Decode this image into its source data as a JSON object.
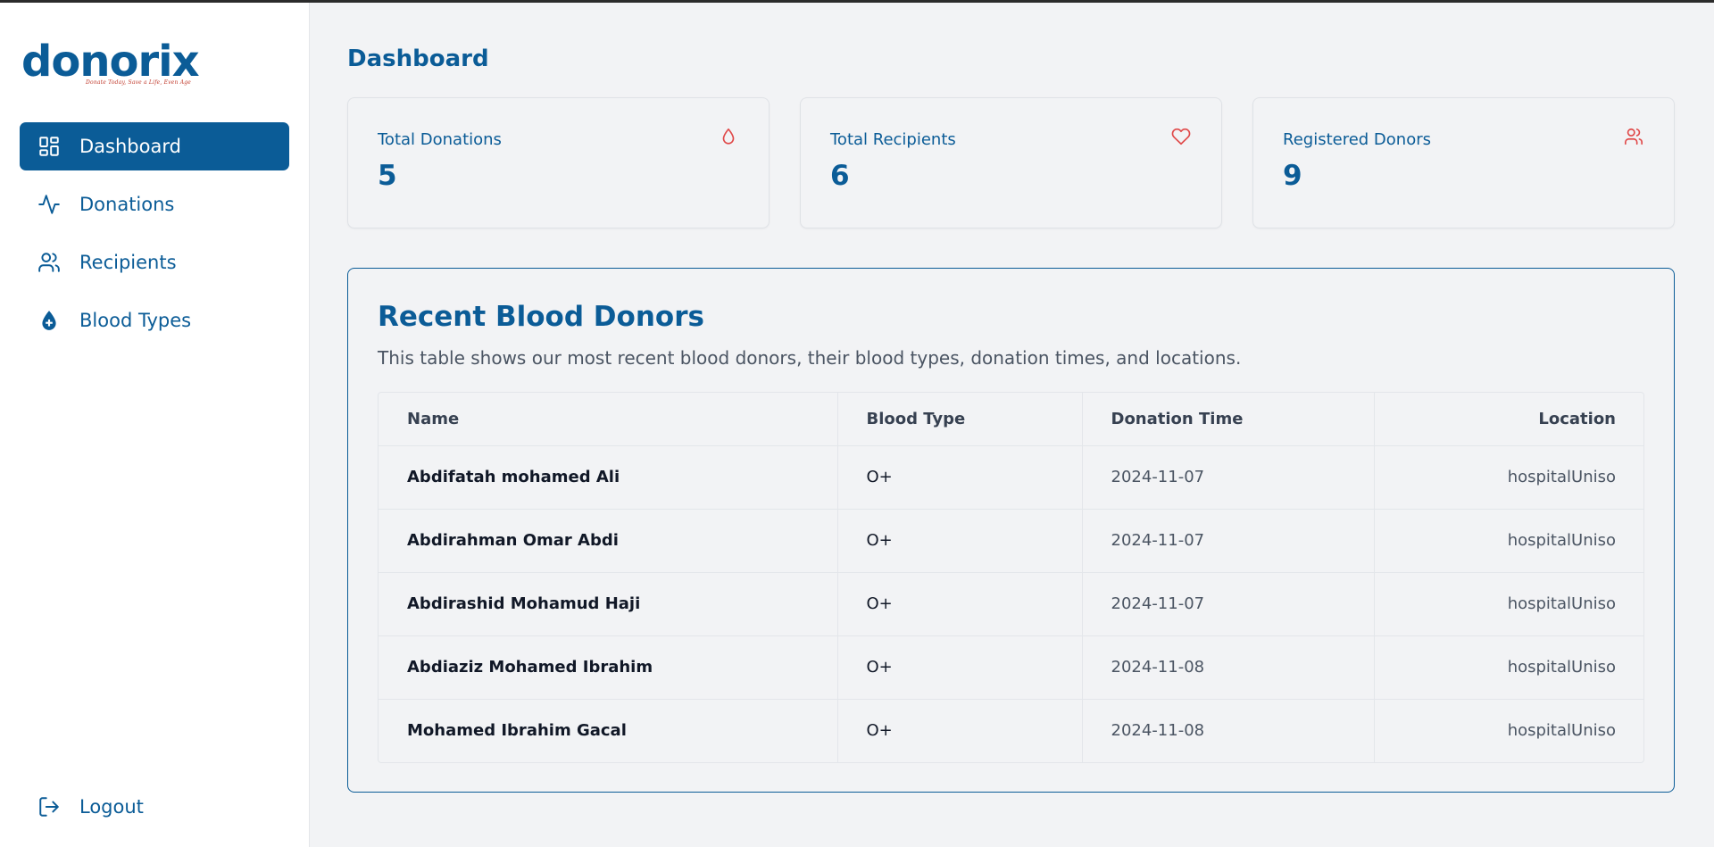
{
  "brand": {
    "name": "donorix",
    "tagline": "Donate Today, Save a Life, Even Age"
  },
  "colors": {
    "primary": "#0b5c97",
    "accent_red": "#e04848",
    "background": "#f2f3f5"
  },
  "sidebar": {
    "items": [
      {
        "label": "Dashboard",
        "icon": "grid-icon",
        "active": true
      },
      {
        "label": "Donations",
        "icon": "activity-icon",
        "active": false
      },
      {
        "label": "Recipients",
        "icon": "users-icon",
        "active": false
      },
      {
        "label": "Blood Types",
        "icon": "blood-drop-icon",
        "active": false
      }
    ],
    "logout_label": "Logout"
  },
  "main": {
    "title": "Dashboard",
    "cards": [
      {
        "label": "Total Donations",
        "value": "5",
        "icon": "droplet-icon"
      },
      {
        "label": "Total Recipients",
        "value": "6",
        "icon": "heart-icon"
      },
      {
        "label": "Registered Donors",
        "value": "9",
        "icon": "users-icon"
      }
    ],
    "recent": {
      "title": "Recent Blood Donors",
      "description": "This table shows our most recent blood donors, their blood types, donation times, and locations.",
      "columns": [
        "Name",
        "Blood Type",
        "Donation Time",
        "Location"
      ],
      "rows": [
        {
          "name": "Abdifatah mohamed Ali",
          "blood_type": "O+",
          "time": "2024-11-07",
          "location": "hospitalUniso"
        },
        {
          "name": "Abdirahman Omar Abdi",
          "blood_type": "O+",
          "time": "2024-11-07",
          "location": "hospitalUniso"
        },
        {
          "name": "Abdirashid Mohamud Haji",
          "blood_type": "O+",
          "time": "2024-11-07",
          "location": "hospitalUniso"
        },
        {
          "name": "Abdiaziz Mohamed Ibrahim",
          "blood_type": "O+",
          "time": "2024-11-08",
          "location": "hospitalUniso"
        },
        {
          "name": "Mohamed Ibrahim Gacal",
          "blood_type": "O+",
          "time": "2024-11-08",
          "location": "hospitalUniso"
        }
      ]
    }
  }
}
